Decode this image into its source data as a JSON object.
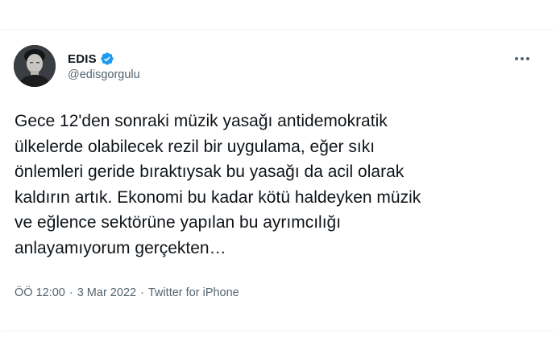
{
  "author": {
    "display_name": "EDIS",
    "handle": "@edisgorgulu",
    "verified": true
  },
  "tweet": {
    "text": "Gece 12'den sonraki müzik yasağı antidemokratik\nülkelerde olabilecek rezil bir uygulama, eğer sıkı\nönlemleri geride bıraktıysak bu yasağı da acil olarak\nkaldırın artık. Ekonomi bu kadar kötü haldeyken müzik\nve eğlence sektörüne yapılan bu ayrımcılığı\nanlayamıyorum gerçekten…"
  },
  "meta": {
    "time": "ÖÖ 12:00",
    "separator": "·",
    "date": "3 Mar 2022",
    "source": "Twitter for iPhone"
  },
  "icons": {
    "verified": "verified-badge-icon",
    "more": "more-dots-icon"
  },
  "colors": {
    "verified": "#1d9bf0",
    "text": "#0f1419",
    "secondary": "#536471"
  }
}
